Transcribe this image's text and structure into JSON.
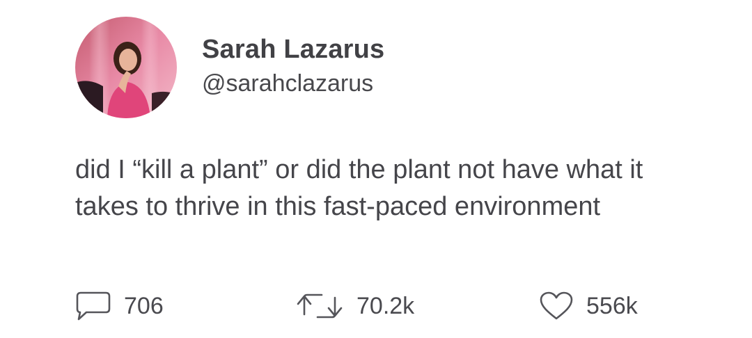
{
  "author": {
    "display_name": "Sarah Lazarus",
    "handle": "@sarahclazarus"
  },
  "tweet": {
    "text": "did I “kill a plant” or did the plant not have what it takes to thrive in this fast-paced environment"
  },
  "actions": {
    "reply": {
      "icon": "speech-bubble-icon",
      "count": "706"
    },
    "retweet": {
      "icon": "retweet-icon",
      "count": "70.2k"
    },
    "like": {
      "icon": "heart-icon",
      "count": "556k"
    }
  },
  "colors": {
    "text": "#45454a",
    "icon": "#55555a",
    "background": "#ffffff"
  }
}
